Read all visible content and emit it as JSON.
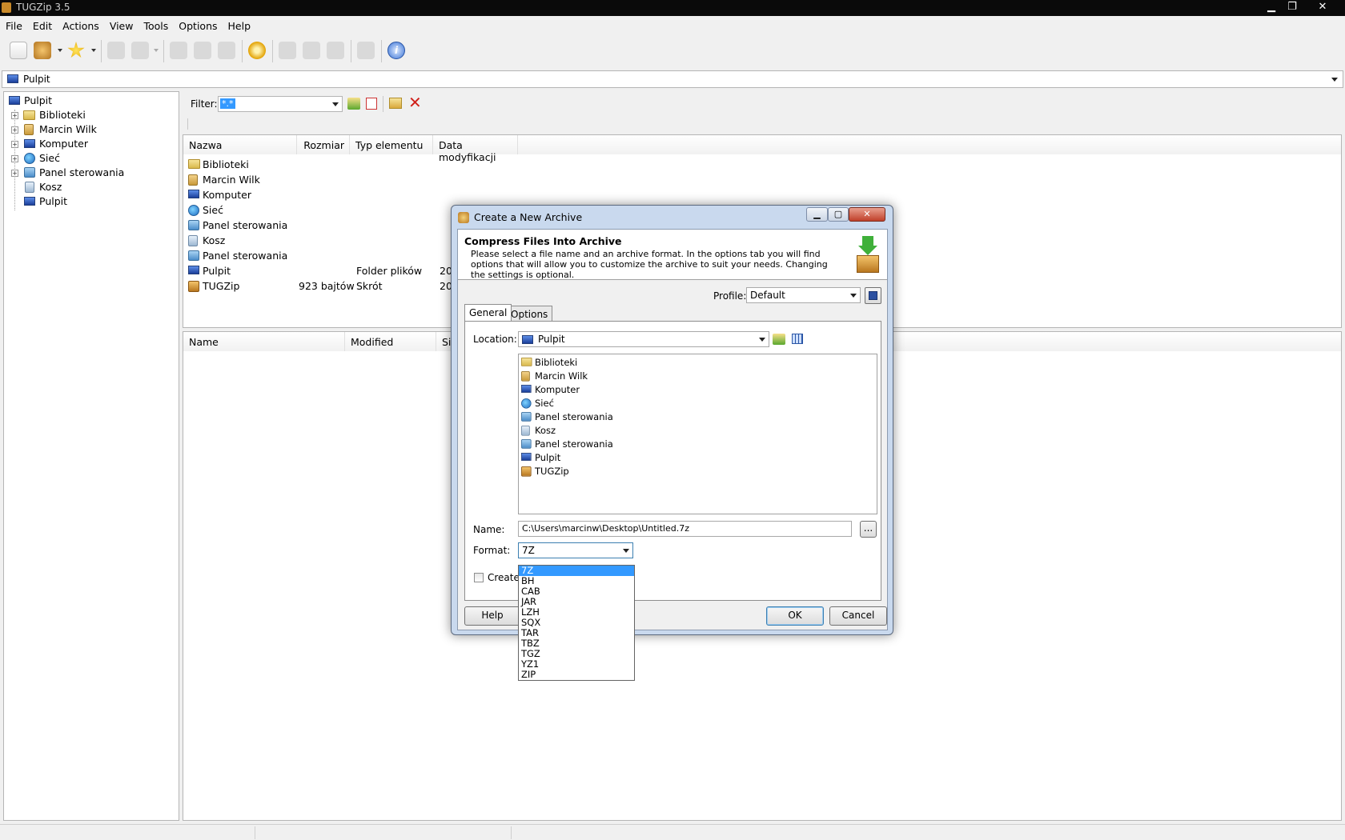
{
  "window": {
    "title": "TUGZip 3.5",
    "controls": {
      "minimize": "▁",
      "maximize": "❐",
      "close": "✕"
    }
  },
  "menu": [
    "File",
    "Edit",
    "Actions",
    "View",
    "Tools",
    "Options",
    "Help"
  ],
  "address": {
    "value": "Pulpit"
  },
  "tree": {
    "root": "Pulpit",
    "items": [
      "Biblioteki",
      "Marcin Wilk",
      "Komputer",
      "Sieć",
      "Panel sterowania",
      "Kosz",
      "Pulpit"
    ]
  },
  "filter": {
    "label": "Filter:",
    "value": "*.*"
  },
  "files_top": {
    "columns": [
      "Nazwa",
      "Rozmiar",
      "Typ elementu",
      "Data modyfikacji"
    ],
    "rows": [
      {
        "name": "Biblioteki",
        "size": "",
        "type": "",
        "date": ""
      },
      {
        "name": "Marcin Wilk",
        "size": "",
        "type": "",
        "date": ""
      },
      {
        "name": "Komputer",
        "size": "",
        "type": "",
        "date": ""
      },
      {
        "name": "Sieć",
        "size": "",
        "type": "",
        "date": ""
      },
      {
        "name": "Panel sterowania",
        "size": "",
        "type": "",
        "date": ""
      },
      {
        "name": "Kosz",
        "size": "",
        "type": "",
        "date": ""
      },
      {
        "name": "Panel sterowania",
        "size": "",
        "type": "",
        "date": ""
      },
      {
        "name": "Pulpit",
        "size": "",
        "type": "Folder plików",
        "date": "20"
      },
      {
        "name": "TUGZip",
        "size": "923 bajtów",
        "type": "Skrót",
        "date": "20"
      }
    ]
  },
  "files_bottom": {
    "columns": [
      "Name",
      "Modified",
      "Si"
    ]
  },
  "dialog": {
    "title": "Create a New Archive",
    "heading": "Compress Files Into Archive",
    "description": "Please select a file name and an archive format. In the options tab you will find options that will allow you to customize the archive to suit your needs. Changing the settings is optional.",
    "profile_label": "Profile:",
    "profile_value": "Default",
    "tabs": [
      "General",
      "Options"
    ],
    "location_label": "Location:",
    "location_value": "Pulpit",
    "location_items": [
      "Biblioteki",
      "Marcin Wilk",
      "Komputer",
      "Sieć",
      "Panel sterowania",
      "Kosz",
      "Panel sterowania",
      "Pulpit",
      "TUGZip"
    ],
    "name_label": "Name:",
    "name_value": "C:\\Users\\marcinw\\Desktop\\Untitled.7z",
    "browse_label": "...",
    "format_label": "Format:",
    "format_value": "7Z",
    "create_checkbox_label": "Create a",
    "help_button": "Help",
    "ok_button": "OK",
    "cancel_button": "Cancel"
  },
  "format_dropdown": {
    "selected": "7Z",
    "options": [
      "7Z",
      "BH",
      "CAB",
      "JAR",
      "LZH",
      "SQX",
      "TAR",
      "TBZ",
      "TGZ",
      "YZ1",
      "ZIP"
    ]
  },
  "colors": {
    "selection": "#3399ff",
    "titlebar": "#0a0a0a",
    "dialog_frame": "#c9d9ee"
  }
}
